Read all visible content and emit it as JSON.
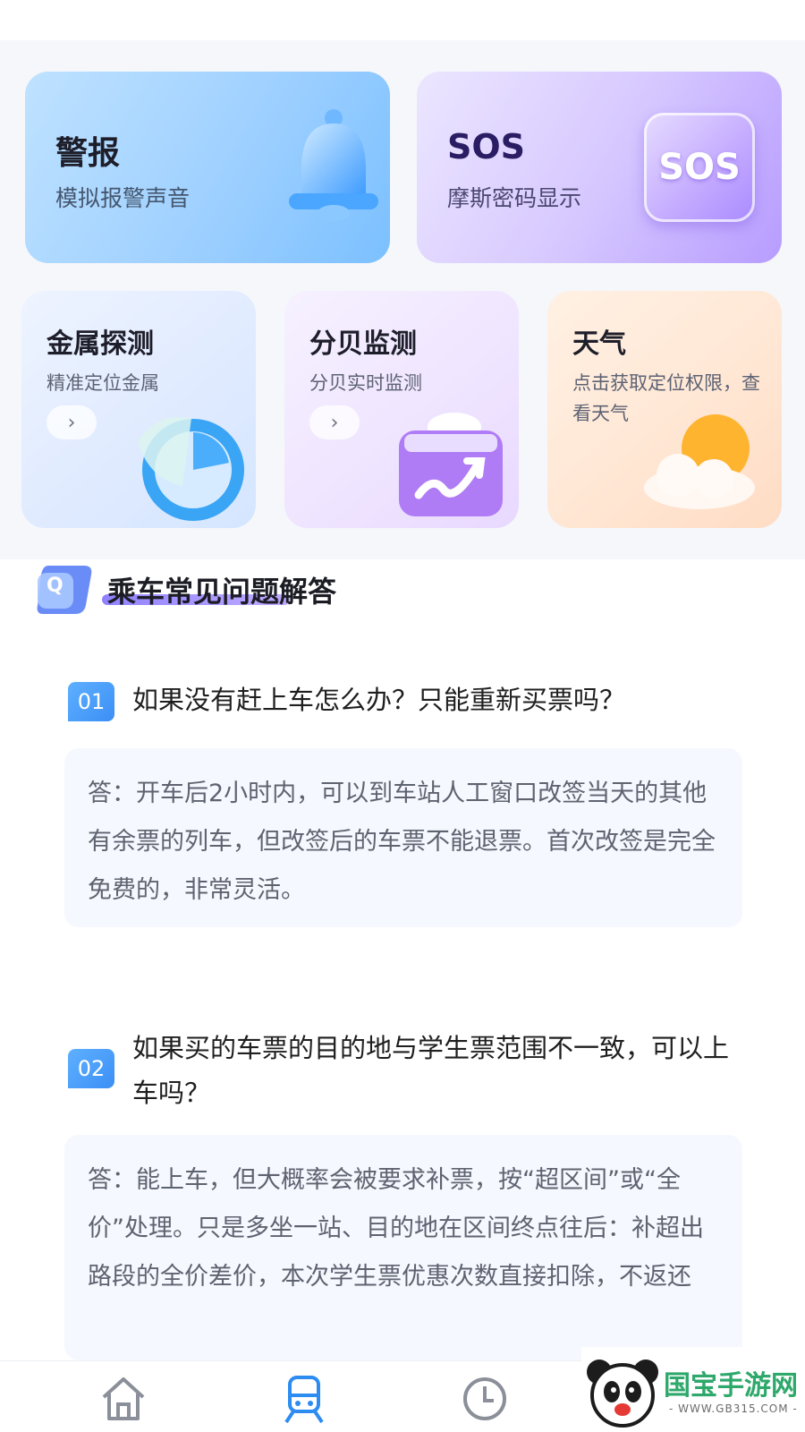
{
  "tools": {
    "alarm": {
      "title": "警报",
      "subtitle": "模拟报警声音"
    },
    "sos": {
      "title": "SOS",
      "subtitle": "摩斯密码显示",
      "badge": "SOS"
    },
    "metal": {
      "title": "金属探测",
      "subtitle": "精准定位金属",
      "arrow": "›"
    },
    "decibel": {
      "title": "分贝监测",
      "subtitle": "分贝实时监测",
      "arrow": "›"
    },
    "weather": {
      "title": "天气",
      "subtitle": "点击获取定位权限，查看天气"
    }
  },
  "faq": {
    "title": "乘车常见问题解答",
    "icon_letter": "Q",
    "items": [
      {
        "num": "01",
        "question": "如果没有赶上车怎么办？只能重新买票吗？",
        "answer": "答：开车后2小时内，可以到车站人工窗口改签当天的其他有余票的列车，但改签后的车票不能退票。首次改签是完全免费的，非常灵活。"
      },
      {
        "num": "02",
        "question": "如果买的车票的目的地与学生票范围不一致，可以上车吗？",
        "answer": "答：能上车，但大概率会被要求补票，按“超区间”或“全价”处理。只是多坐一站、目的地在区间终点往后：补超出路段的全价差价，本次学生票优惠次数直接扣除，不返还"
      }
    ]
  },
  "nav": {
    "items": [
      {
        "icon": "home-icon"
      },
      {
        "icon": "train-icon"
      },
      {
        "icon": "clock-icon"
      }
    ]
  },
  "watermark": {
    "name": "国宝手游网",
    "url": "- WWW.GB315.COM -"
  },
  "colors": {
    "accent": "#3b8ff5",
    "purple": "#7c6cff"
  }
}
